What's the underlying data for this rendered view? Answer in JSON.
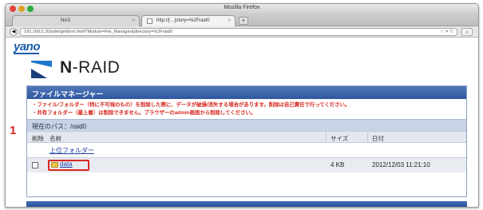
{
  "window": {
    "title": "Mozilla Firefox",
    "tabs": [
      {
        "label": "NAS"
      },
      {
        "label": "http://[…]ctory=%2Fraid0"
      }
    ],
    "url": "192.168.0.20/adm/getform.html?Module=File_Manager&directory=%2Fraid0"
  },
  "brand": {
    "vendor": "yano",
    "product_n": "N",
    "product_rest": "-RAID"
  },
  "panel": {
    "title": "ファイルマネージャー",
    "warnings": [
      "・ファイル/フォルダー（特に不可視のもの）を削除した際に、データが破損/消失する場合があります。削除は自己責任で行ってください。",
      "・共有フォルダー（最上層）は削除できません。ブラウザーのadmin画面から削除してください。"
    ],
    "current_path": "現在のパス：/raid0",
    "columns": {
      "delete": "削除",
      "name": "名前",
      "size": "サイズ",
      "date": "日付"
    },
    "up_folder": "上位フォルダー",
    "rows": [
      {
        "name": "data",
        "size": "4 KB",
        "date": "2012/12/03 11:21:10"
      }
    ]
  },
  "annotation": {
    "label": "1",
    "color": "#d6281f"
  },
  "colors": {
    "header": "#2f57a0",
    "warning": "#d6281f",
    "link": "#1f3fa8",
    "path_bg": "#c9d3e6"
  }
}
